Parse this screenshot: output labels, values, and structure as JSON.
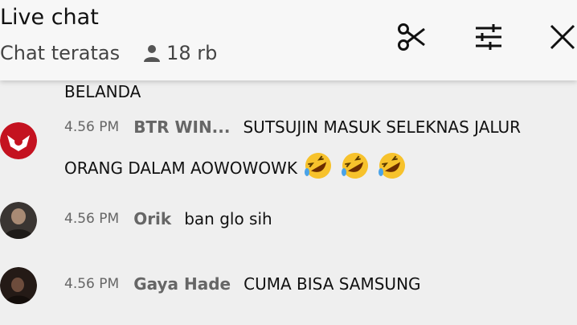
{
  "header": {
    "title": "Live chat",
    "subtitle": "Chat teratas",
    "viewers": "18 rb",
    "icons": [
      "scissors-icon",
      "sliders-icon",
      "close-icon"
    ]
  },
  "messages": [
    {
      "continuation": "BELANDA"
    },
    {
      "time": "4.56 PM",
      "author": "BTR WIN...",
      "text_line1": "SUTSUJIN MASUK SELEKNAS JALUR",
      "text_line2": "ORANG DALAM AOWOWOWK",
      "emoji": [
        "rofl-emoji",
        "rofl-emoji",
        "rofl-emoji"
      ]
    },
    {
      "time": "4.56 PM",
      "author": "Orik",
      "text": "ban glo sih"
    },
    {
      "time": "4.56 PM",
      "author": "Gaya Hade",
      "text": "CUMA BISA SAMSUNG"
    }
  ],
  "colors": {
    "background": "#efefef",
    "header": "#f7f7f7",
    "meta": "#666666"
  }
}
